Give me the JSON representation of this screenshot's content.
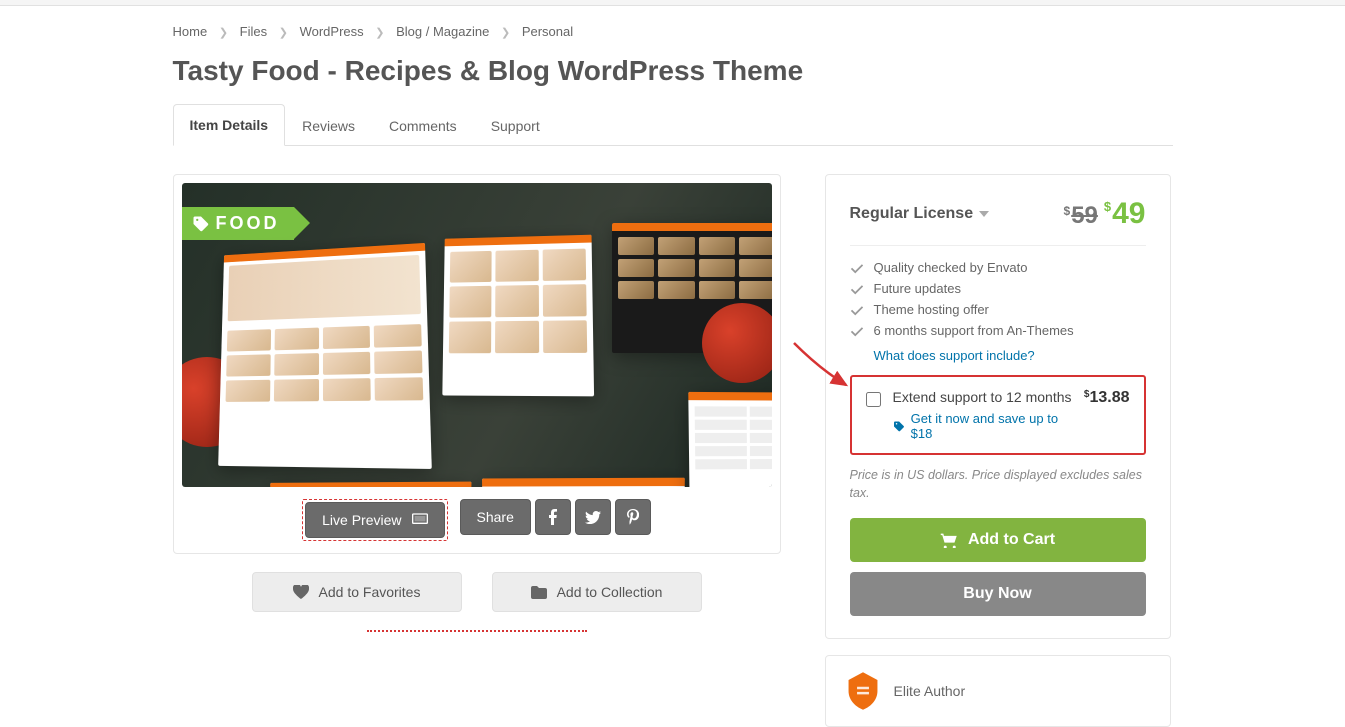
{
  "breadcrumbs": [
    "Home",
    "Files",
    "WordPress",
    "Blog / Magazine",
    "Personal"
  ],
  "page_title": "Tasty Food - Recipes & Blog WordPress Theme",
  "tabs": {
    "details": "Item Details",
    "reviews": "Reviews",
    "comments": "Comments",
    "support": "Support"
  },
  "hero": {
    "label": "FOOD"
  },
  "buttons": {
    "live_preview": "Live Preview",
    "share": "Share",
    "add_favorites": "Add to Favorites",
    "add_collection": "Add to Collection",
    "add_cart": "Add to Cart",
    "buy_now": "Buy Now"
  },
  "purchase": {
    "license_label": "Regular License",
    "old_price": "59",
    "new_price": "49",
    "features": [
      "Quality checked by Envato",
      "Future updates",
      "Theme hosting offer",
      "6 months support from An-Themes"
    ],
    "support_link": "What does support include?",
    "extend": {
      "label": "Extend support to 12 months",
      "price": "13.88",
      "promo": "Get it now and save up to $18"
    },
    "fine_print": "Price is in US dollars. Price displayed excludes sales tax."
  },
  "elite": {
    "label": "Elite Author"
  }
}
